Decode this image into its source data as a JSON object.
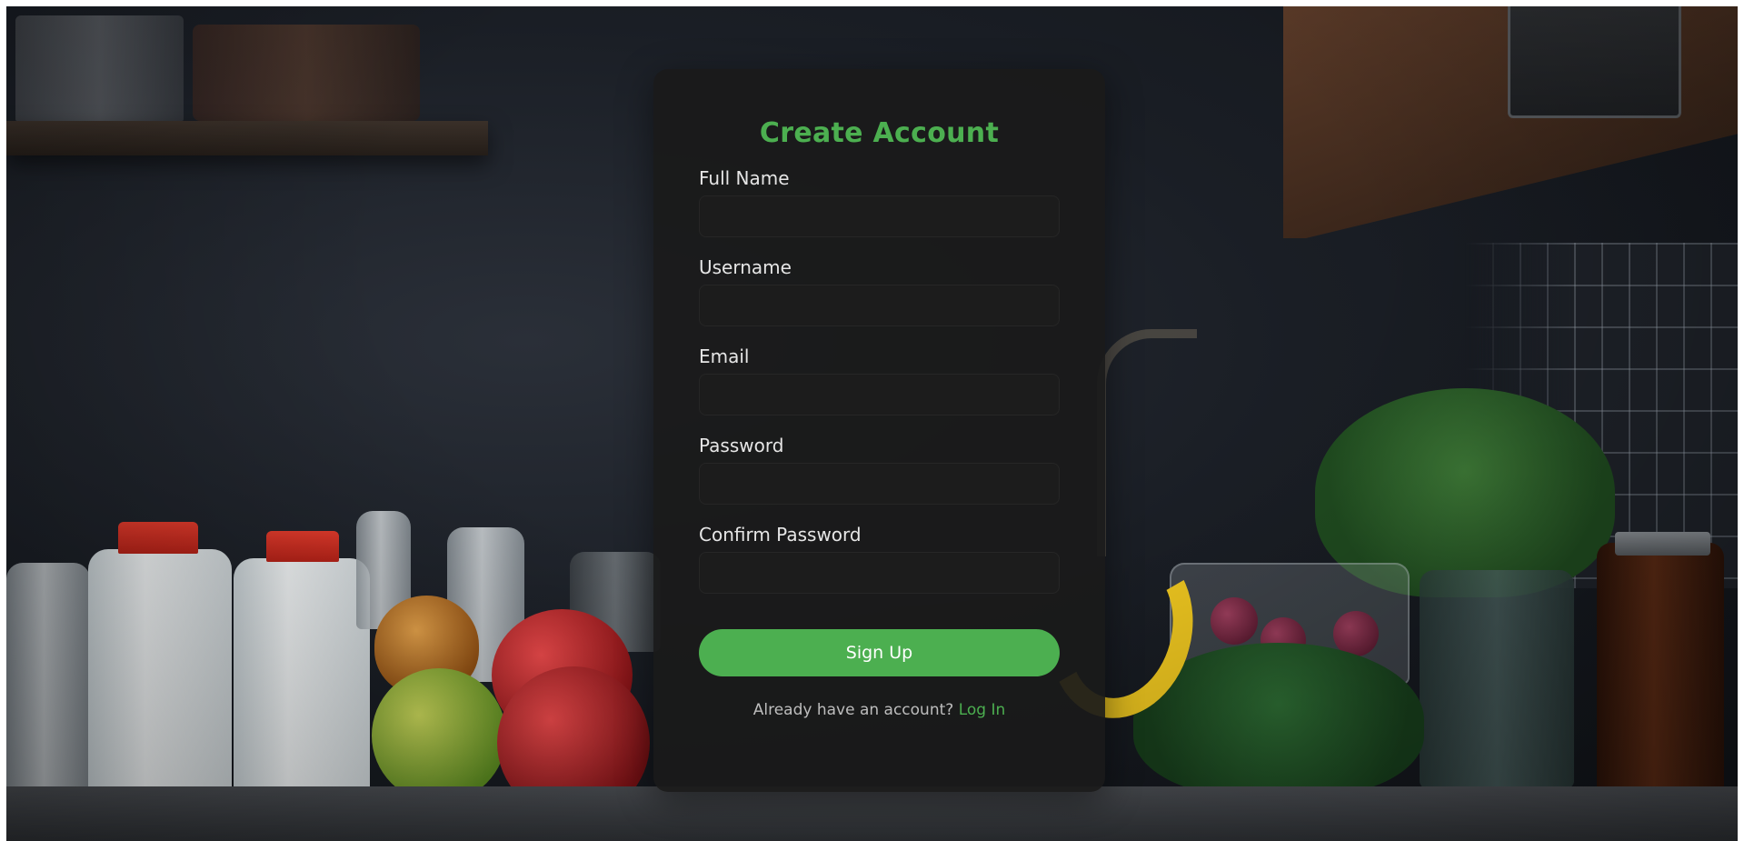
{
  "signup_form": {
    "title": "Create Account",
    "fields": [
      {
        "label": "Full Name",
        "value": "",
        "type": "text"
      },
      {
        "label": "Username",
        "value": "",
        "type": "text"
      },
      {
        "label": "Email",
        "value": "",
        "type": "email"
      },
      {
        "label": "Password",
        "value": "",
        "type": "password"
      },
      {
        "label": "Confirm Password",
        "value": "",
        "type": "password"
      }
    ],
    "submit_label": "Sign Up",
    "login_prompt": "Already have an account?",
    "login_link": "Log In"
  },
  "colors": {
    "accent": "#4caf50",
    "card_background": "#1a1a1a",
    "input_background": "#1c1c1c",
    "label_text": "#e6e6e6"
  }
}
